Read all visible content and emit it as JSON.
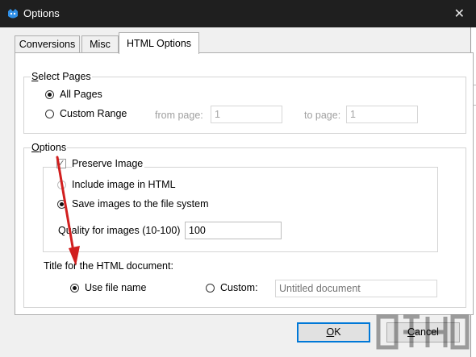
{
  "window": {
    "title": "Options",
    "close_glyph": "✕"
  },
  "tabs": [
    {
      "label": "Conversions",
      "active": false
    },
    {
      "label": "Misc",
      "active": false
    },
    {
      "label": "HTML Options",
      "active": true
    }
  ],
  "select_pages": {
    "legend_mnemonic": "S",
    "legend_rest": "elect Pages",
    "all_pages": {
      "label": "All Pages",
      "checked": true
    },
    "custom_range": {
      "label": "Custom Range",
      "checked": false
    },
    "from_label": "from page:",
    "from_value": "1",
    "to_label": "to page:",
    "to_value": "1"
  },
  "options": {
    "legend_mnemonic": "O",
    "legend_rest": "ptions",
    "preserve_image": {
      "label": "Preserve Image",
      "checked": true
    },
    "include_in_html": {
      "label": "Include image in HTML",
      "checked": false
    },
    "save_to_fs": {
      "label": "Save images to the file system",
      "checked": true
    },
    "quality_label": "Quality for images (10-100)",
    "quality_value": "100",
    "title_label": "Title for the HTML document:",
    "use_file_name": {
      "label": "Use file name",
      "checked": true
    },
    "custom": {
      "label": "Custom:",
      "checked": false
    },
    "custom_placeholder": "Untitled document"
  },
  "buttons": {
    "ok_mnemonic": "O",
    "ok_rest": "K",
    "cancel_mnemonic": "C",
    "cancel_rest": "ancel"
  },
  "colors": {
    "titlebar": "#1f1f1f",
    "annotation_arrow": "#d11f1f",
    "accent": "#0078d7"
  }
}
